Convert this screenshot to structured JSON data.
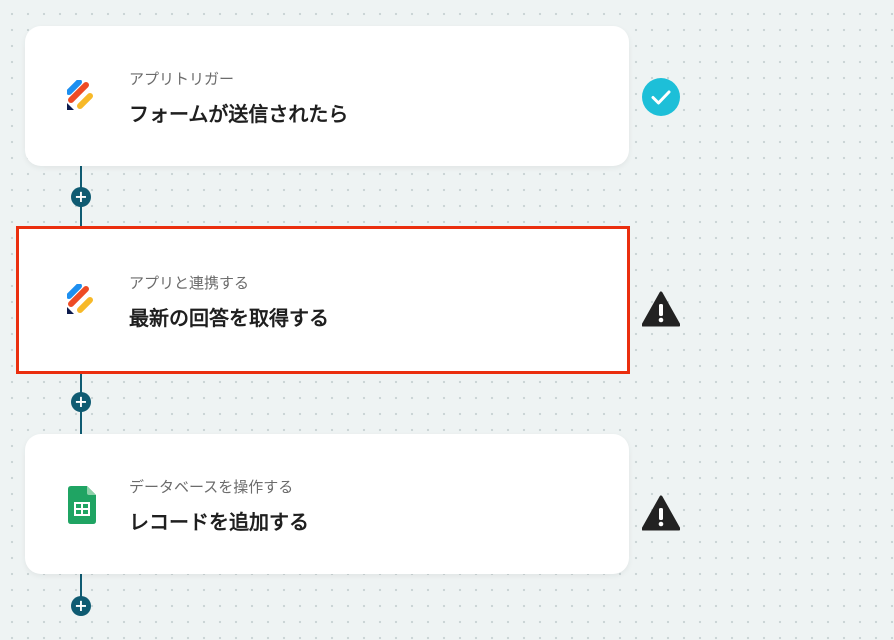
{
  "flow": {
    "steps": [
      {
        "subtitle": "アプリトリガー",
        "title": "フォームが送信されたら",
        "icon": "form-app-icon",
        "status": "completed-check-icon"
      },
      {
        "subtitle": "アプリと連携する",
        "title": "最新の回答を取得する",
        "icon": "form-app-icon",
        "status": "warning-icon"
      },
      {
        "subtitle": "データベースを操作する",
        "title": "レコードを追加する",
        "icon": "google-sheets-icon",
        "status": "warning-icon"
      }
    ],
    "add_step_label": "+"
  },
  "colors": {
    "connector": "#0f5b72",
    "check": "#1dbfd8",
    "warning": "#222222",
    "selected_outline": "#ea2e0e",
    "sheets_green": "#1fa463"
  }
}
